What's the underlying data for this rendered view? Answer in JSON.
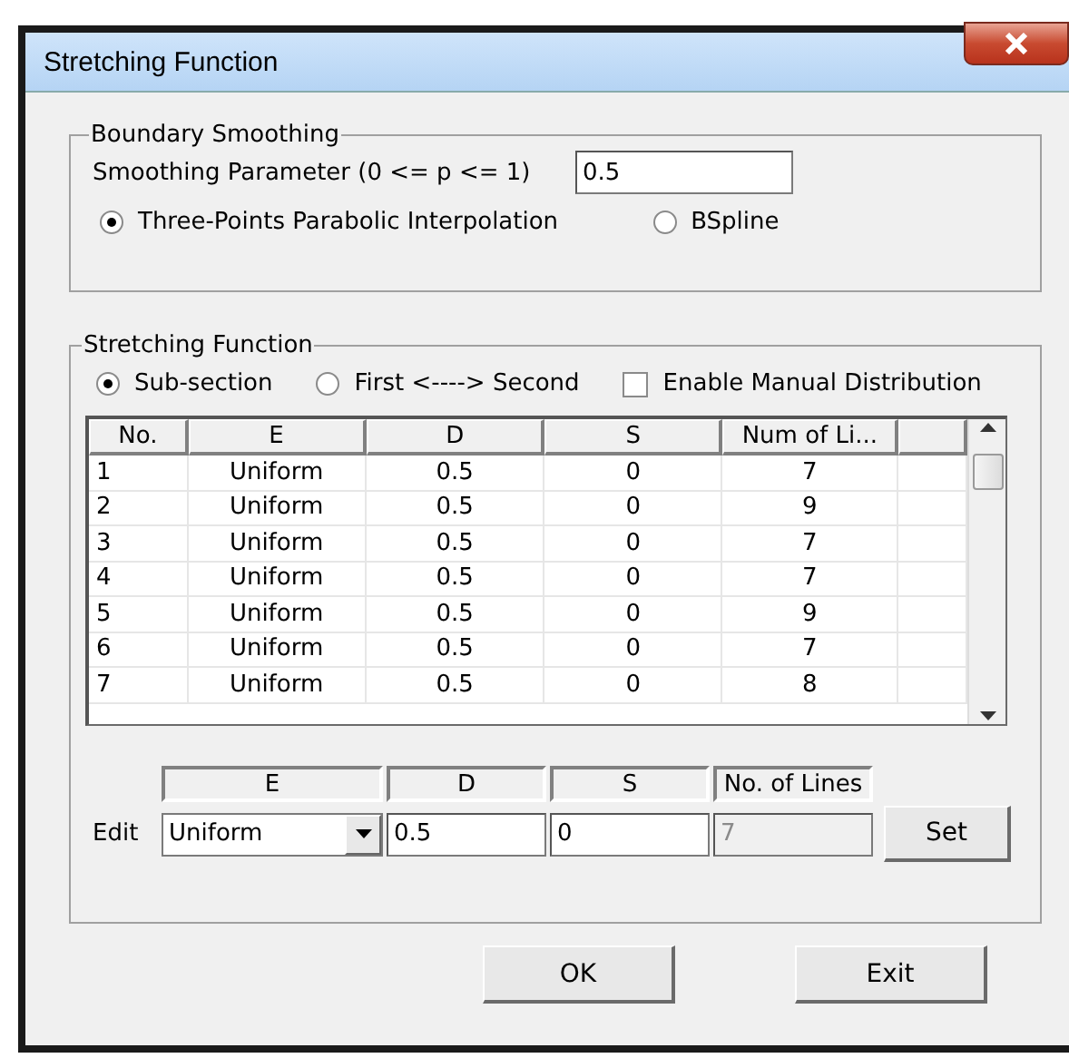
{
  "window": {
    "title": "Stretching Function"
  },
  "boundary_smoothing": {
    "title": "Boundary Smoothing",
    "parameter_label": "Smoothing Parameter (0 <= p <= 1)",
    "parameter_value": "0.5",
    "options": [
      {
        "label": "Three-Points Parabolic Interpolation",
        "selected": true
      },
      {
        "label": "BSpline",
        "selected": false
      }
    ]
  },
  "stretching_function": {
    "title": "Stretching Function",
    "modes": [
      {
        "label": "Sub-section",
        "selected": true
      },
      {
        "label": "First <----> Second",
        "selected": false
      }
    ],
    "manual_distribution": {
      "label": "Enable Manual Distribution",
      "checked": false
    },
    "table": {
      "columns": [
        "No.",
        "E",
        "D",
        "S",
        "Num of Li..."
      ],
      "rows": [
        [
          "1",
          "Uniform",
          "0.5",
          "0",
          "7"
        ],
        [
          "2",
          "Uniform",
          "0.5",
          "0",
          "9"
        ],
        [
          "3",
          "Uniform",
          "0.5",
          "0",
          "7"
        ],
        [
          "4",
          "Uniform",
          "0.5",
          "0",
          "7"
        ],
        [
          "5",
          "Uniform",
          "0.5",
          "0",
          "9"
        ],
        [
          "6",
          "Uniform",
          "0.5",
          "0",
          "7"
        ],
        [
          "7",
          "Uniform",
          "0.5",
          "0",
          "8"
        ]
      ]
    },
    "edit": {
      "label": "Edit",
      "columns": [
        "E",
        "D",
        "S",
        "No. of Lines"
      ],
      "e_value": "Uniform",
      "d_value": "0.5",
      "s_value": "0",
      "lines_value": "7",
      "lines_disabled": true,
      "set_button": "Set"
    }
  },
  "buttons": [
    "OK",
    "Exit"
  ]
}
